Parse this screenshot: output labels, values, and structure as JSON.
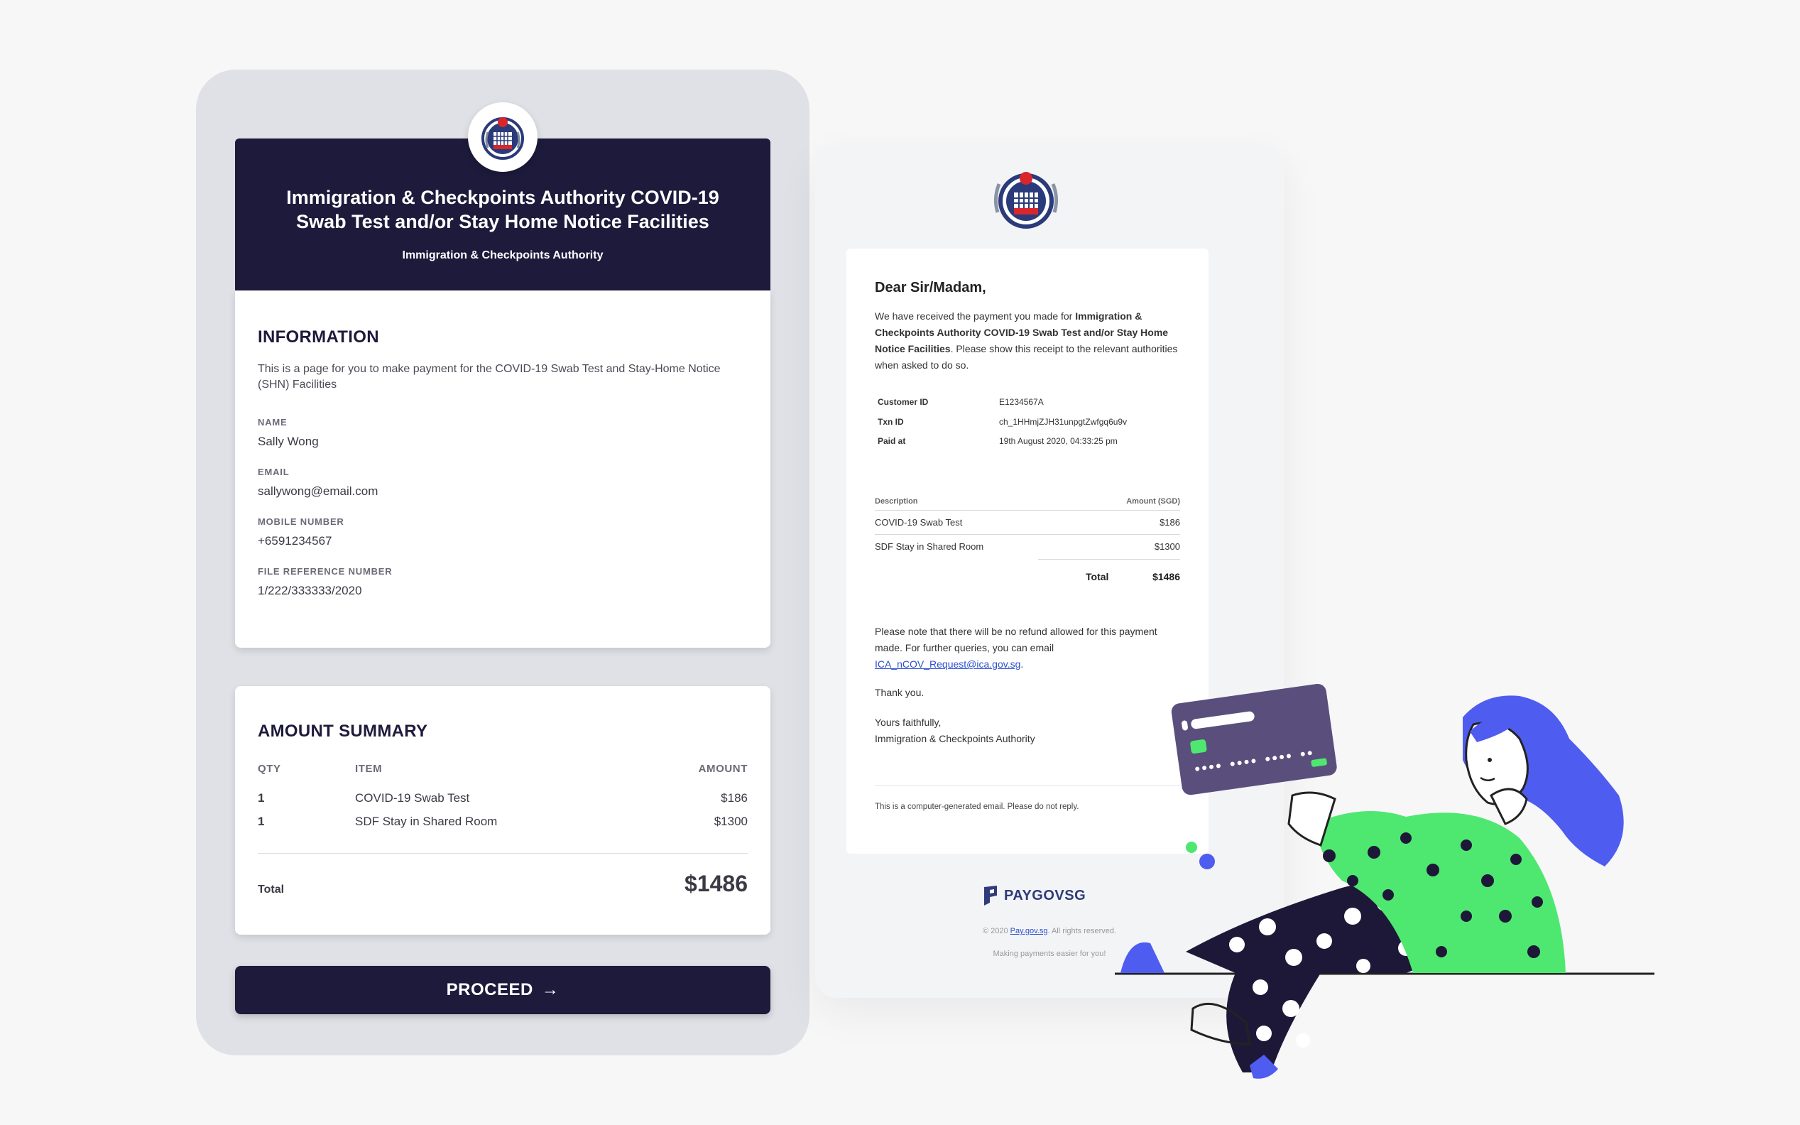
{
  "payment_form": {
    "header": {
      "title": "Immigration & Checkpoints Authority COVID-19 Swab Test and/or Stay Home Notice Facilities",
      "subtitle": "Immigration & Checkpoints Authority"
    },
    "information": {
      "heading": "INFORMATION",
      "description": "This is a page for you to make payment for the COVID-19 Swab Test and Stay-Home Notice (SHN) Facilities",
      "fields": [
        {
          "label": "NAME",
          "value": "Sally Wong"
        },
        {
          "label": "EMAIL",
          "value": "sallywong@email.com"
        },
        {
          "label": "MOBILE NUMBER",
          "value": "+6591234567"
        },
        {
          "label": "FILE REFERENCE NUMBER",
          "value": "1/222/333333/2020"
        }
      ]
    },
    "amount_summary": {
      "heading": "AMOUNT SUMMARY",
      "columns": {
        "qty": "QTY",
        "item": "ITEM",
        "amount": "AMOUNT"
      },
      "rows": [
        {
          "qty": "1",
          "item": "COVID-19 Swab Test",
          "amount": "$186"
        },
        {
          "qty": "1",
          "item": "SDF Stay in Shared Room",
          "amount": "$1300"
        }
      ],
      "total_label": "Total",
      "total_value": "$1486"
    },
    "proceed_label": "PROCEED",
    "proceed_arrow": "→"
  },
  "receipt_email": {
    "greeting": "Dear Sir/Madam,",
    "body_prefix": "We have received the payment you made for ",
    "body_bold": "Immigration & Checkpoints Authority COVID-19 Swab Test and/or Stay Home Notice Facilities",
    "body_suffix": ". Please show this receipt to the relevant authorities when asked to do so.",
    "details": [
      {
        "key": "Customer ID",
        "value": "E1234567A"
      },
      {
        "key": "Txn ID",
        "value": "ch_1HHmjZJH31unpgtZwfgq6u9v"
      },
      {
        "key": "Paid at",
        "value": "19th August 2020, 04:33:25 pm"
      }
    ],
    "table": {
      "desc_header": "Description",
      "amount_header": "Amount (SGD)",
      "rows": [
        {
          "desc": "COVID-19 Swab Test",
          "amount": "$186"
        },
        {
          "desc": "SDF Stay in Shared Room",
          "amount": "$1300"
        }
      ],
      "total_label": "Total",
      "total_value": "$1486"
    },
    "note_text": "Please note that there will be no refund allowed for this payment made. For further queries, you can email",
    "note_email": "ICA_nCOV_Request@ica.gov.sg",
    "note_end": ".",
    "thanks": "Thank you.",
    "signoff_1": "Yours faithfully,",
    "signoff_2": "Immigration & Checkpoints Authority",
    "auto_note": "This is a computer-generated email. Please do not reply.",
    "brand": "PAYGOVSG",
    "copyright_prefix": "© 2020 ",
    "copyright_link": "Pay.gov.sg",
    "copyright_suffix": ". All rights reserved.",
    "tagline": "Making payments easier for you!"
  },
  "colors": {
    "navy": "#1d1a3b",
    "accent_blue": "#4f5cf0",
    "accent_green": "#4ee870",
    "card_purple": "#5a4f7c",
    "link_blue": "#2c4ed0"
  },
  "icons": [
    "ica-crest-icon",
    "arrow-right-icon",
    "paygov-logo-icon"
  ]
}
